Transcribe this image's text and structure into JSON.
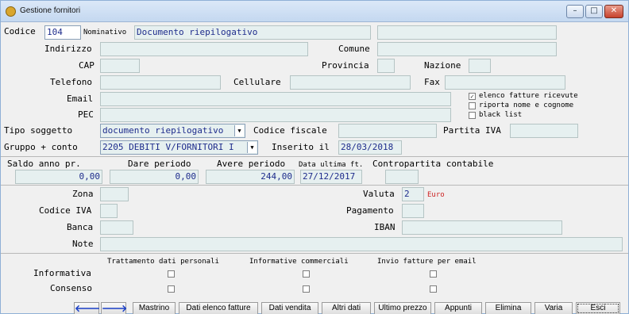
{
  "window": {
    "title": "Gestione fornitori"
  },
  "titlebar_buttons": {
    "minimize": "–",
    "maximize": "□",
    "close": "✕"
  },
  "colors": {
    "field_bg": "#e6f0f0",
    "value_text": "#1e2c8c",
    "currency_text": "#cc2222",
    "title_gradient": "#c4d8f0"
  },
  "anagrafica": {
    "codice_label": "Codice",
    "codice_value": "104",
    "nominativo_label": "Nominativo",
    "nominativo_value": "Documento riepilogativo",
    "nominativo2_value": "",
    "indirizzo_label": "Indirizzo",
    "indirizzo_value": "",
    "comune_label": "Comune",
    "comune_value": "",
    "cap_label": "CAP",
    "cap_value": "",
    "provincia_label": "Provincia",
    "provincia_value": "",
    "nazione_label": "Nazione",
    "nazione_value": "",
    "telefono_label": "Telefono",
    "telefono_value": "",
    "cellulare_label": "Cellulare",
    "cellulare_value": "",
    "fax_label": "Fax",
    "fax_value": "",
    "email_label": "Email",
    "email_value": "",
    "pec_label": "PEC",
    "pec_value": ""
  },
  "options": {
    "elenco_fatture_label": "elenco fatture ricevute",
    "elenco_fatture_checked": "✓",
    "riporta_nome_label": "riporta nome e cognome",
    "riporta_nome_checked": "",
    "black_list_label": "black list",
    "black_list_checked": ""
  },
  "fiscale": {
    "tipo_soggetto_label": "Tipo soggetto",
    "tipo_soggetto_value": "documento riepilogativo",
    "codice_fiscale_label": "Codice fiscale",
    "codice_fiscale_value": "",
    "partita_iva_label": "Partita IVA",
    "partita_iva_value": "",
    "gruppo_conto_label": "Gruppo + conto",
    "gruppo_conto_value": "2205 DEBITI V/FORNITORI I",
    "inserito_il_label": "Inserito il",
    "inserito_il_value": "28/03/2018"
  },
  "saldi": {
    "saldo_anno_pr_label": "Saldo anno pr.",
    "saldo_anno_pr_value": "0,00",
    "dare_periodo_label": "Dare periodo",
    "dare_periodo_value": "0,00",
    "avere_periodo_label": "Avere periodo",
    "avere_periodo_value": "244,00",
    "data_ultima_ft_label": "Data ultima ft.",
    "data_ultima_ft_value": "27/12/2017",
    "contropartita_label": "Contropartita contabile",
    "contropartita_value": ""
  },
  "pagamento": {
    "zona_label": "Zona",
    "zona_value": "",
    "valuta_label": "Valuta",
    "valuta_value": "2",
    "valuta_desc": "Euro",
    "codice_iva_label": "Codice IVA",
    "codice_iva_value": "",
    "pagamento_label": "Pagamento",
    "pagamento_value": "",
    "banca_label": "Banca",
    "banca_value": "",
    "iban_label": "IBAN",
    "iban_value": "",
    "note_label": "Note",
    "note_value": ""
  },
  "privacy": {
    "col_trattamento": "Trattamento dati personali",
    "col_informative": "Informative commerciali",
    "col_invio": "Invio fatture per email",
    "row_informativa": "Informativa",
    "row_consenso": "Consenso"
  },
  "toolbar": {
    "back_icon": "🡐",
    "forward_icon": "🡒",
    "mastrino": "Mastrino",
    "dati_elenco_fatture": "Dati elenco fatture",
    "dati_vendita": "Dati vendita",
    "altri_dati": "Altri dati",
    "ultimo_prezzo": "Ultimo prezzo",
    "appunti": "Appunti",
    "elimina": "Elimina",
    "varia": "Varia",
    "esci": "Esci"
  }
}
